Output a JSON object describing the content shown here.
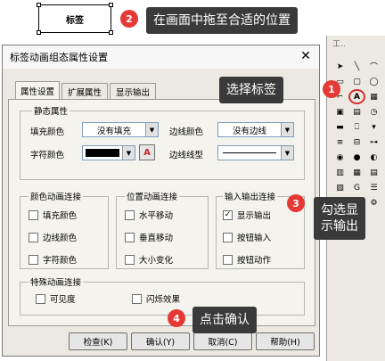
{
  "canvas_label": {
    "text": "标签"
  },
  "dialog": {
    "title": "标签动画组态属性设置",
    "close_symbol": "✕",
    "tabs": [
      "属性设置",
      "扩展属性",
      "显示输出"
    ],
    "static_group": {
      "title": "静态属性",
      "fill_color_label": "填充颜色",
      "fill_color_value": "没有填充",
      "border_color_label": "边线颜色",
      "border_color_value": "没有边线",
      "font_color_label": "字符颜色",
      "font_btn": "A",
      "border_style_label": "边线线型"
    },
    "color_anim_group": {
      "title": "颜色动画连接",
      "items": [
        "填充颜色",
        "边线颜色",
        "字符颜色"
      ]
    },
    "pos_anim_group": {
      "title": "位置动画连接",
      "items": [
        "水平移动",
        "垂直移动",
        "大小变化"
      ]
    },
    "io_group": {
      "title": "输入输出连接",
      "items": [
        "显示输出",
        "按钮输入",
        "按钮动作"
      ],
      "checked": "✓"
    },
    "special_group": {
      "title": "特殊动画连接",
      "items": [
        "可见度",
        "闪烁效果"
      ]
    },
    "buttons": [
      "检查(K)",
      "确认(Y)",
      "取消(C)",
      "帮助(H)"
    ]
  },
  "palette": {
    "header": "工..",
    "icons": [
      "pointer-icon",
      "line-icon",
      "arc-icon",
      "rect-icon",
      "round-rect-icon",
      "ellipse-icon",
      "polyline-icon",
      "label-icon",
      "bitmap-icon",
      "image-icon",
      "component-icon",
      "timer-icon",
      "standard-button-icon",
      "input-box-icon",
      "combo-icon",
      "lines-icon",
      "slider-icon",
      "switch-icon",
      "gauge-icon",
      "indicator-icon",
      "knob-icon",
      "chart-icon",
      "grid-icon",
      "table-icon",
      "record-icon",
      "gif-icon",
      "list-icon",
      "frame-icon",
      "custom-icon",
      "tool-icon"
    ],
    "label_glyph": "A"
  },
  "callouts": {
    "c1": {
      "num": "1",
      "text": "选择标签"
    },
    "c2": {
      "num": "2",
      "text": "在画面中拖至合适的位置"
    },
    "c3": {
      "num": "3",
      "text_line1": "勾选显",
      "text_line2": "示输出"
    },
    "c4": {
      "num": "4",
      "text": "点击确认"
    }
  },
  "colors": {
    "accent_red": "#e53935",
    "callout_bg": "#3a3a3a",
    "selected_outline": "#d32f2f"
  }
}
